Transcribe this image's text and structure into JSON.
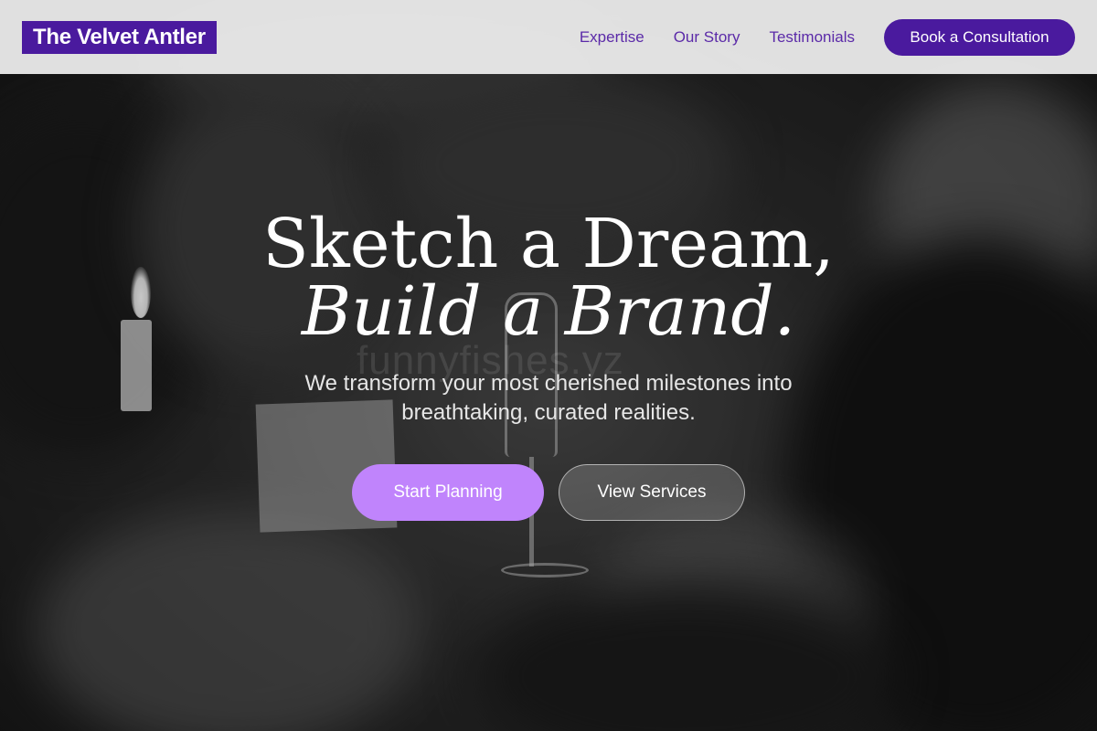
{
  "navbar": {
    "brand": "The Velvet Antler",
    "links": [
      {
        "label": "Expertise"
      },
      {
        "label": "Our Story"
      },
      {
        "label": "Testimonials"
      }
    ],
    "cta_label": "Book a Consultation"
  },
  "hero": {
    "headline_line1": "Sketch a Dream,",
    "headline_line2": "Build a Brand.",
    "subtitle": "We transform your most cherished milestones into breathtaking, curated realities.",
    "primary_button": "Start Planning",
    "secondary_button": "View Services"
  },
  "watermark": "funnyfishes.yz",
  "colors": {
    "brand_purple": "#4a1a9e",
    "nav_link_purple": "#5b2aa8",
    "primary_button": "#c084fc"
  }
}
